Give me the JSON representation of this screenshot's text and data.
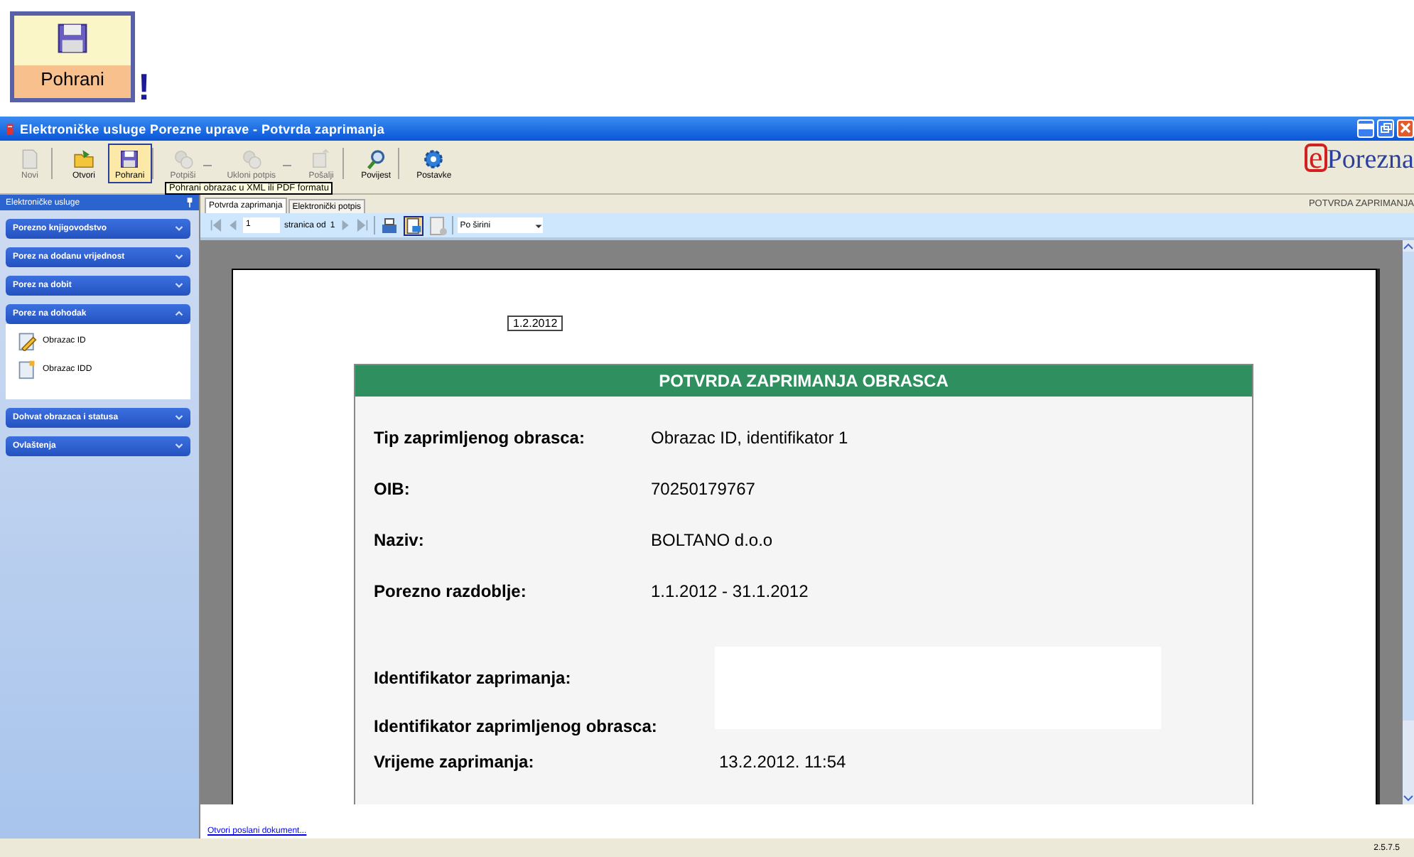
{
  "banner": {
    "label": "Pohrani",
    "mark": "!"
  },
  "window": {
    "title": "Elektroničke usluge Porezne uprave - Potvrda zaprimanja"
  },
  "toolbar": [
    {
      "label": "Novi",
      "disabled": true,
      "selected": false,
      "menu": false,
      "separator_after": true
    },
    {
      "label": "Otvori",
      "disabled": false,
      "selected": false,
      "menu": false,
      "separator_after": false
    },
    {
      "label": "Pohrani",
      "disabled": false,
      "selected": true,
      "menu": false,
      "separator_after": true
    },
    {
      "label": "Potpiši",
      "disabled": true,
      "selected": false,
      "menu": true,
      "separator_after": false
    },
    {
      "label": "Ukloni potpis",
      "disabled": true,
      "selected": false,
      "menu": true,
      "separator_after": false
    },
    {
      "label": "Pošalji",
      "disabled": true,
      "selected": false,
      "menu": false,
      "separator_after": true
    },
    {
      "label": "Povijest",
      "disabled": false,
      "selected": false,
      "menu": false,
      "separator_after": true
    },
    {
      "label": "Postavke",
      "disabled": false,
      "selected": false,
      "menu": false,
      "separator_after": false
    }
  ],
  "tooltip": "Pohrani obrazac u XML ili PDF formatu",
  "logo": {
    "letter": "e",
    "name": "Porezna"
  },
  "header_caption": "POTVRDA ZAPRIMANJA",
  "sidebar": {
    "title": "Elektroničke usluge",
    "groups": [
      {
        "label": "Porezno knjigovodstvo",
        "expanded": false
      },
      {
        "label": "Porez na dodanu vrijednost",
        "expanded": false
      },
      {
        "label": "Porez na dobit",
        "expanded": false
      },
      {
        "label": "Porez na dohodak",
        "expanded": true,
        "items": [
          {
            "label": "Obrazac ID"
          },
          {
            "label": "Obrazac IDD"
          }
        ]
      },
      {
        "label": "Dohvat obrazaca i statusa",
        "expanded": false
      },
      {
        "label": "Ovlaštenja",
        "expanded": false
      }
    ]
  },
  "tabs": [
    {
      "label": "Potvrda zaprimanja",
      "selected": true
    },
    {
      "label": "Elektronički potpis",
      "selected": false
    }
  ],
  "report_toolbar": {
    "page": "1",
    "page_of": "stranica od",
    "page_count": "1",
    "zoom": "Po širini"
  },
  "document": {
    "date": "1.2.2012",
    "heading": "POTVRDA ZAPRIMANJA OBRASCA",
    "fields": [
      {
        "label": "Tip zaprimljenog obrasca:",
        "value": "Obrazac ID, identifikator 1"
      },
      {
        "label": "OIB:",
        "value": "70250179767"
      },
      {
        "label": "Naziv:",
        "value": "BOLTANO d.o.o"
      },
      {
        "label": "Porezno razdoblje:",
        "value": "1.1.2012 - 31.1.2012"
      }
    ],
    "receipt_fields": [
      {
        "label": "Identifikator zaprimanja:"
      },
      {
        "label": "Identifikator zaprimljenog obrasca:"
      }
    ],
    "received": {
      "label": "Vrijeme zaprimanja:",
      "value": "13.2.2012. 11:54"
    }
  },
  "link": "Otvori poslani dokument...",
  "status": {
    "version": "2.5.7.5"
  }
}
